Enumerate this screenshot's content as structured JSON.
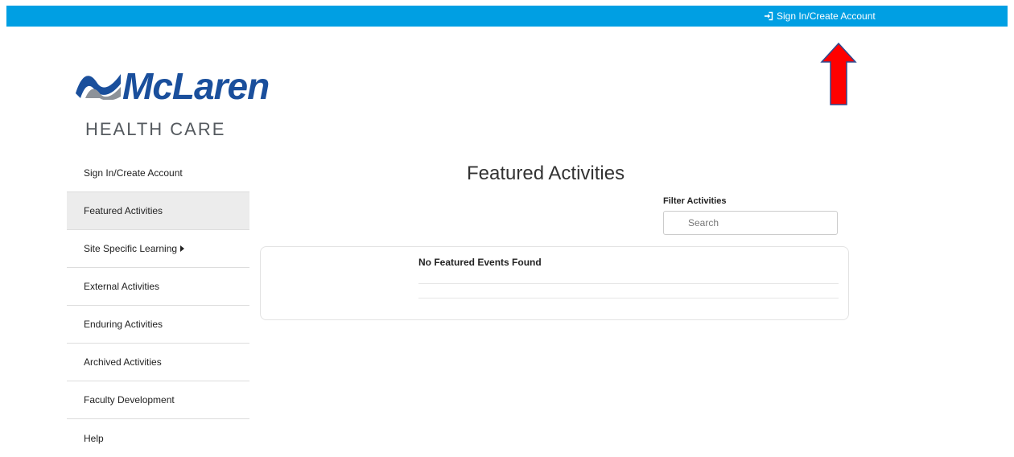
{
  "header": {
    "signin_label": "Sign In/Create Account",
    "signin_icon": "sign-in-icon",
    "bar_color": "#009fe3"
  },
  "logo": {
    "name": "McLaren",
    "subtitle": "HEALTH CARE",
    "brand_color": "#1a4f9c"
  },
  "annotation": {
    "arrow_color": "#ff0000",
    "arrow_outline_color": "#2f4a8f"
  },
  "sidebar": {
    "items": [
      {
        "label": "Sign In/Create Account"
      },
      {
        "label": "Featured Activities"
      },
      {
        "label": "Site Specific Learning"
      },
      {
        "label": "External Activities"
      },
      {
        "label": "Enduring Activities"
      },
      {
        "label": "Archived Activities"
      },
      {
        "label": "Faculty Development"
      },
      {
        "label": "Help"
      }
    ],
    "active_index": 1
  },
  "main": {
    "title": "Featured Activities",
    "filter": {
      "label": "Filter Activities",
      "placeholder": "Search"
    },
    "empty_message": "No Featured Events Found"
  }
}
